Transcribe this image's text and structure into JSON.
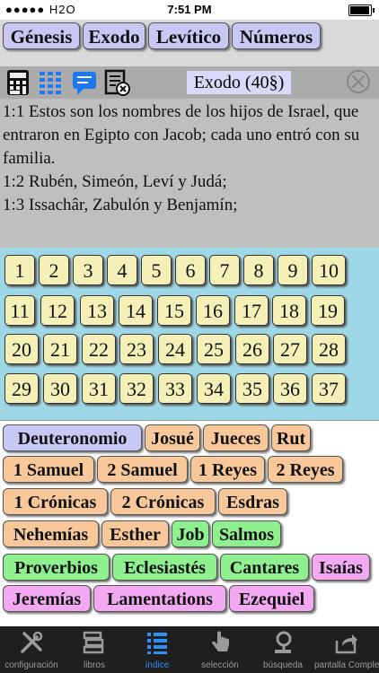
{
  "status": {
    "carrier": "●●●●● H2O",
    "time": "7:51 PM"
  },
  "top_books": [
    "Génesis",
    "Exodo",
    "Levítico",
    "Números"
  ],
  "chapter_title": "Exodo (40§)",
  "verses": [
    "1:1  Estos son los nombres de los hijos de Israel, que entraron en Egipto con Jacob; cada uno entró con su familia.",
    "1:2  Rubén, Simeón, Leví y Judá;",
    "1:3  Issachâr, Zabulón y Benjamín;"
  ],
  "chapters": [
    "1",
    "2",
    "3",
    "4",
    "5",
    "6",
    "7",
    "8",
    "9",
    "10",
    "11",
    "12",
    "13",
    "14",
    "15",
    "16",
    "17",
    "18",
    "19",
    "20",
    "21",
    "22",
    "23",
    "24",
    "25",
    "26",
    "27",
    "28",
    "29",
    "30",
    "31",
    "32",
    "33",
    "34",
    "35",
    "36",
    "37"
  ],
  "books": [
    {
      "name": "Deuteronomio",
      "color": "#c8c8f5"
    },
    {
      "name": "Josué",
      "color": "#f8c89a"
    },
    {
      "name": "Jueces",
      "color": "#f8c89a"
    },
    {
      "name": "Rut",
      "color": "#f8c89a"
    },
    {
      "name": "1 Samuel",
      "color": "#f8c89a"
    },
    {
      "name": "2 Samuel",
      "color": "#f8c89a"
    },
    {
      "name": "1 Reyes",
      "color": "#f8c89a"
    },
    {
      "name": "2 Reyes",
      "color": "#f8c89a"
    },
    {
      "name": "1 Crónicas",
      "color": "#f8c89a"
    },
    {
      "name": "2 Crónicas",
      "color": "#f8c89a"
    },
    {
      "name": "Esdras",
      "color": "#f8c89a"
    },
    {
      "name": "Nehemías",
      "color": "#f8c89a"
    },
    {
      "name": "Esther",
      "color": "#f8c89a"
    },
    {
      "name": "Job",
      "color": "#8ef08e"
    },
    {
      "name": "Salmos",
      "color": "#8ef08e"
    },
    {
      "name": "Proverbios",
      "color": "#8ef08e"
    },
    {
      "name": "Eclesiastés",
      "color": "#8ef08e"
    },
    {
      "name": "Cantares",
      "color": "#8ef08e"
    },
    {
      "name": "Isaías",
      "color": "#f2a9f2"
    },
    {
      "name": "Jeremías",
      "color": "#f2a9f2"
    },
    {
      "name": "Lamentations",
      "color": "#f2a9f2"
    },
    {
      "name": "Ezequiel",
      "color": "#f2a9f2"
    }
  ],
  "tabs": [
    {
      "label": "configuración",
      "icon": "tools-icon"
    },
    {
      "label": "libros",
      "icon": "books-icon"
    },
    {
      "label": "índice",
      "icon": "list-icon",
      "active": true
    },
    {
      "label": "selección",
      "icon": "hand-pointer-icon"
    },
    {
      "label": "búsqueda",
      "icon": "search-book-icon"
    },
    {
      "label": "pantalla Completa",
      "icon": "share-icon"
    }
  ],
  "accent_color": "#2f8ff3"
}
